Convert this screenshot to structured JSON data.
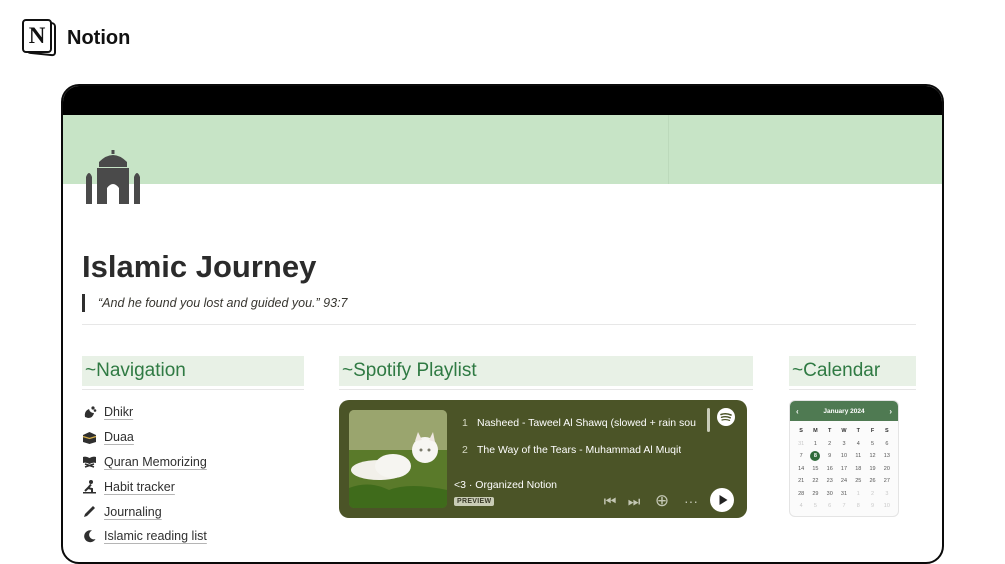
{
  "brand": {
    "name": "Notion"
  },
  "page": {
    "title": "Islamic Journey",
    "quote": "“And he found you lost and guided you.” 93:7"
  },
  "sections": {
    "navigation": "~Navigation",
    "spotify": "~Spotify Playlist",
    "calendar": "~Calendar"
  },
  "navigation": {
    "items": [
      {
        "label": "Dhikr",
        "icon": "prayer-beads-icon"
      },
      {
        "label": "Duaa",
        "icon": "kaaba-icon"
      },
      {
        "label": "Quran Memorizing",
        "icon": "open-book-stand-icon"
      },
      {
        "label": "Habit tracker",
        "icon": "person-praying-icon"
      },
      {
        "label": "Journaling",
        "icon": "pencil-icon"
      },
      {
        "label": "Islamic reading list",
        "icon": "crescent-moon-icon"
      }
    ]
  },
  "spotify": {
    "tracks": [
      {
        "num": "1",
        "title": "Nasheed - Taweel Al Shawq (slowed + rain sou"
      },
      {
        "num": "2",
        "title": "The Way of the Tears - Muhammad Al Muqit"
      }
    ],
    "playlist": "<3 · Organized Notion",
    "badge": "PREVIEW",
    "controls": {
      "prev": "⏮",
      "next": "⏭",
      "add": "⊕",
      "more": "···"
    }
  },
  "calendar": {
    "month": "January 2024",
    "prev": "‹",
    "next": "›",
    "weekdays": [
      "S",
      "M",
      "T",
      "W",
      "T",
      "F",
      "S"
    ],
    "days": [
      [
        "31",
        "1",
        "2",
        "3",
        "4",
        "5",
        "6"
      ],
      [
        "7",
        "8",
        "9",
        "10",
        "11",
        "12",
        "13"
      ],
      [
        "14",
        "15",
        "16",
        "17",
        "18",
        "19",
        "20"
      ],
      [
        "21",
        "22",
        "23",
        "24",
        "25",
        "26",
        "27"
      ],
      [
        "28",
        "29",
        "30",
        "31",
        "1",
        "2",
        "3"
      ],
      [
        "4",
        "5",
        "6",
        "7",
        "8",
        "9",
        "10"
      ]
    ],
    "today": "8"
  },
  "colors": {
    "cover": "#c7e4c6",
    "section_header_bg": "#e8f1e6",
    "section_header_text": "#2f7a43",
    "spotify_bg": "#4b5427",
    "calendar_header": "#4f7a52"
  }
}
